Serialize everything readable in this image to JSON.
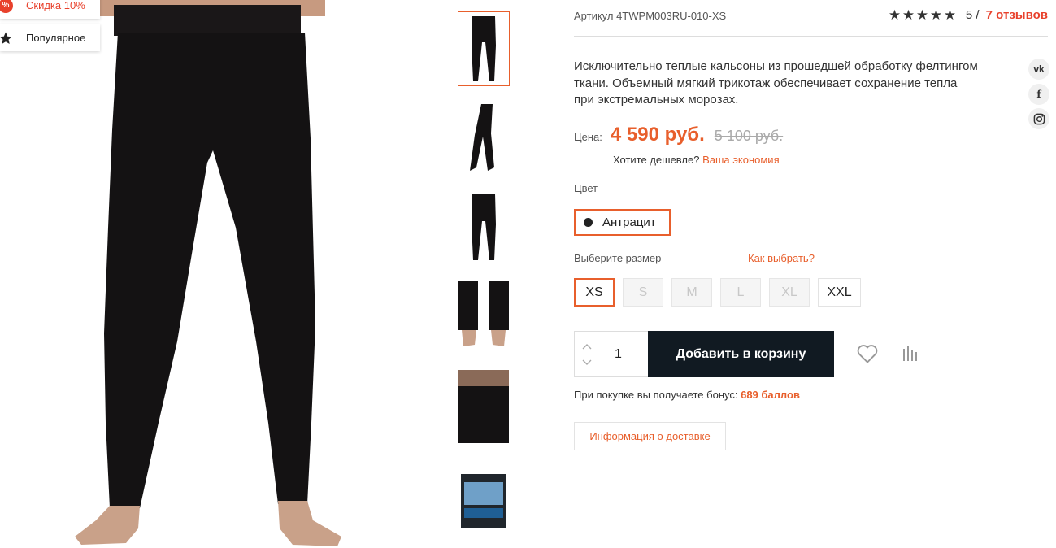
{
  "badges": {
    "sale": "Скидка 10%",
    "sale_icon": "%",
    "popular": "Популярное"
  },
  "product": {
    "sku": "Артикул 4TWPM003RU-010-XS",
    "rating_value": "5",
    "rating_separator": " / ",
    "reviews": "7 отзывов",
    "stars": 5,
    "description": "Исключительно теплые кальсоны из прошедшей обработку фелтингом ткани. Объемный мягкий трикотаж обеспечивает сохранение тепла при экстремальных морозах."
  },
  "price": {
    "label": "Цена:",
    "current": "4 590 руб.",
    "old": "5 100 руб.",
    "cheaper_q": "Хотите дешевле?",
    "cheaper_link": "Ваша экономия"
  },
  "color": {
    "label": "Цвет",
    "selected": "Антрацит"
  },
  "size": {
    "label": "Выберите размер",
    "help": "Как выбрать?",
    "options": [
      "XS",
      "S",
      "M",
      "L",
      "XL",
      "XXL"
    ]
  },
  "cart": {
    "quantity": "1",
    "add_label": "Добавить в корзину"
  },
  "bonus": {
    "text": "При покупке вы получаете бонус:",
    "value": "689 баллов"
  },
  "delivery": {
    "label": "Информация о доставке"
  },
  "social": {
    "vk": "vk",
    "fb": "f"
  },
  "colors": {
    "accent": "#e85f2c",
    "button_bg": "#111a22",
    "sale": "#e8412c"
  },
  "icons": [
    "percent-icon",
    "star-icon",
    "heart-icon",
    "compare-icon",
    "vk-icon",
    "facebook-icon",
    "instagram-icon",
    "arrow-up-icon",
    "arrow-down-icon"
  ]
}
